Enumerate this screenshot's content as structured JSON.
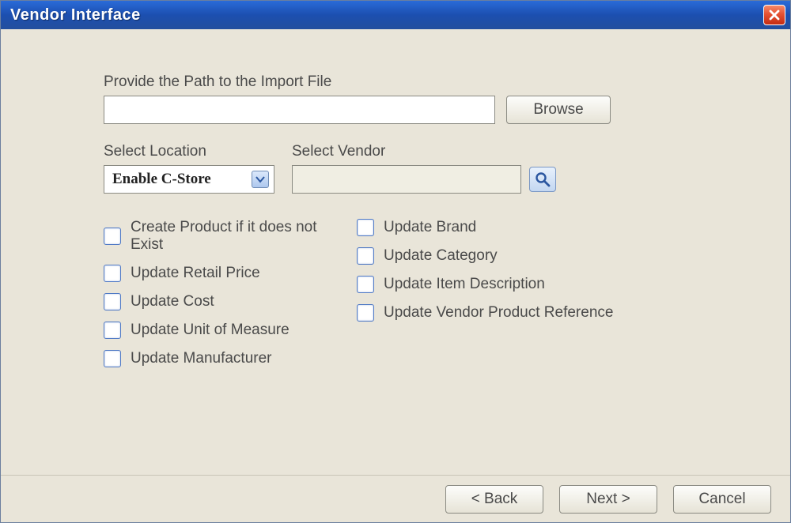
{
  "title": "Vendor Interface",
  "labels": {
    "path": "Provide the Path to the Import File",
    "location": "Select Location",
    "vendor": "Select Vendor"
  },
  "inputs": {
    "path_value": "",
    "location_selected": "Enable C-Store",
    "vendor_value": ""
  },
  "buttons": {
    "browse": "Browse",
    "back": "< Back",
    "next": "Next >",
    "cancel": "Cancel"
  },
  "checks": {
    "left": [
      "Create Product if it does not Exist",
      "Update Retail Price",
      "Update Cost",
      "Update Unit of Measure",
      "Update Manufacturer"
    ],
    "right": [
      "Update Brand",
      "Update Category",
      "Update Item Description",
      "Update Vendor Product Reference"
    ]
  }
}
